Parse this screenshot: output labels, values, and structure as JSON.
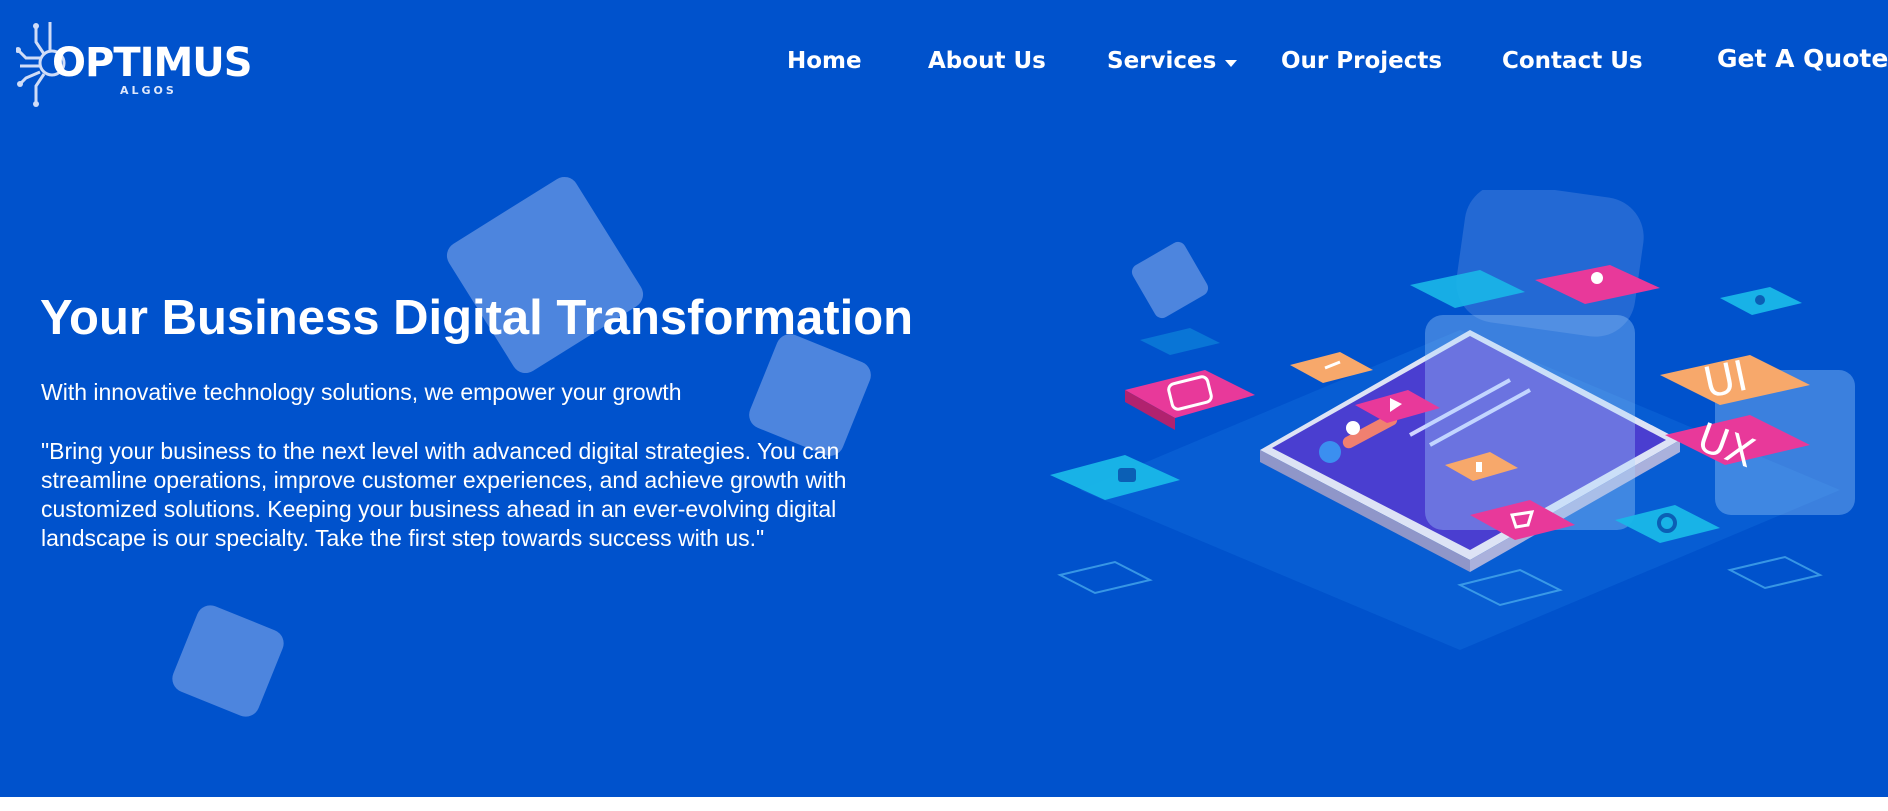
{
  "header": {
    "logo": {
      "name": "OPTIMUS",
      "sub": "ALGOS"
    },
    "nav": [
      {
        "label": "Home"
      },
      {
        "label": "About Us"
      },
      {
        "label": "Services"
      },
      {
        "label": "Our Projects"
      },
      {
        "label": "Contact Us"
      }
    ],
    "cta_label": "Get A Quote"
  },
  "hero": {
    "title": "Your Business Digital Transformation",
    "subtitle": "With innovative technology solutions, we empower your growth",
    "paragraph": "\"Bring your business to the next level with advanced digital strategies. You can streamline operations, improve customer experiences, and achieve growth with customized solutions. Keeping your business ahead in an ever-evolving digital landscape is our specialty. Take the first step towards success with us.\"",
    "illustration": {
      "tile_text_1": "UI",
      "tile_text_2": "UX"
    }
  },
  "colors": {
    "hero_background": "#0052cc",
    "text": "#ffffff",
    "pink_tile": "#e8399a",
    "orange_tile": "#f7a86b",
    "cyan_tile": "#19b7e8"
  },
  "icons": [
    "circuit-logo-icon",
    "chevron-down-icon",
    "chat-icon",
    "play-icon",
    "cart-icon",
    "lock-icon",
    "gear-icon",
    "user-icon",
    "location-icon"
  ]
}
